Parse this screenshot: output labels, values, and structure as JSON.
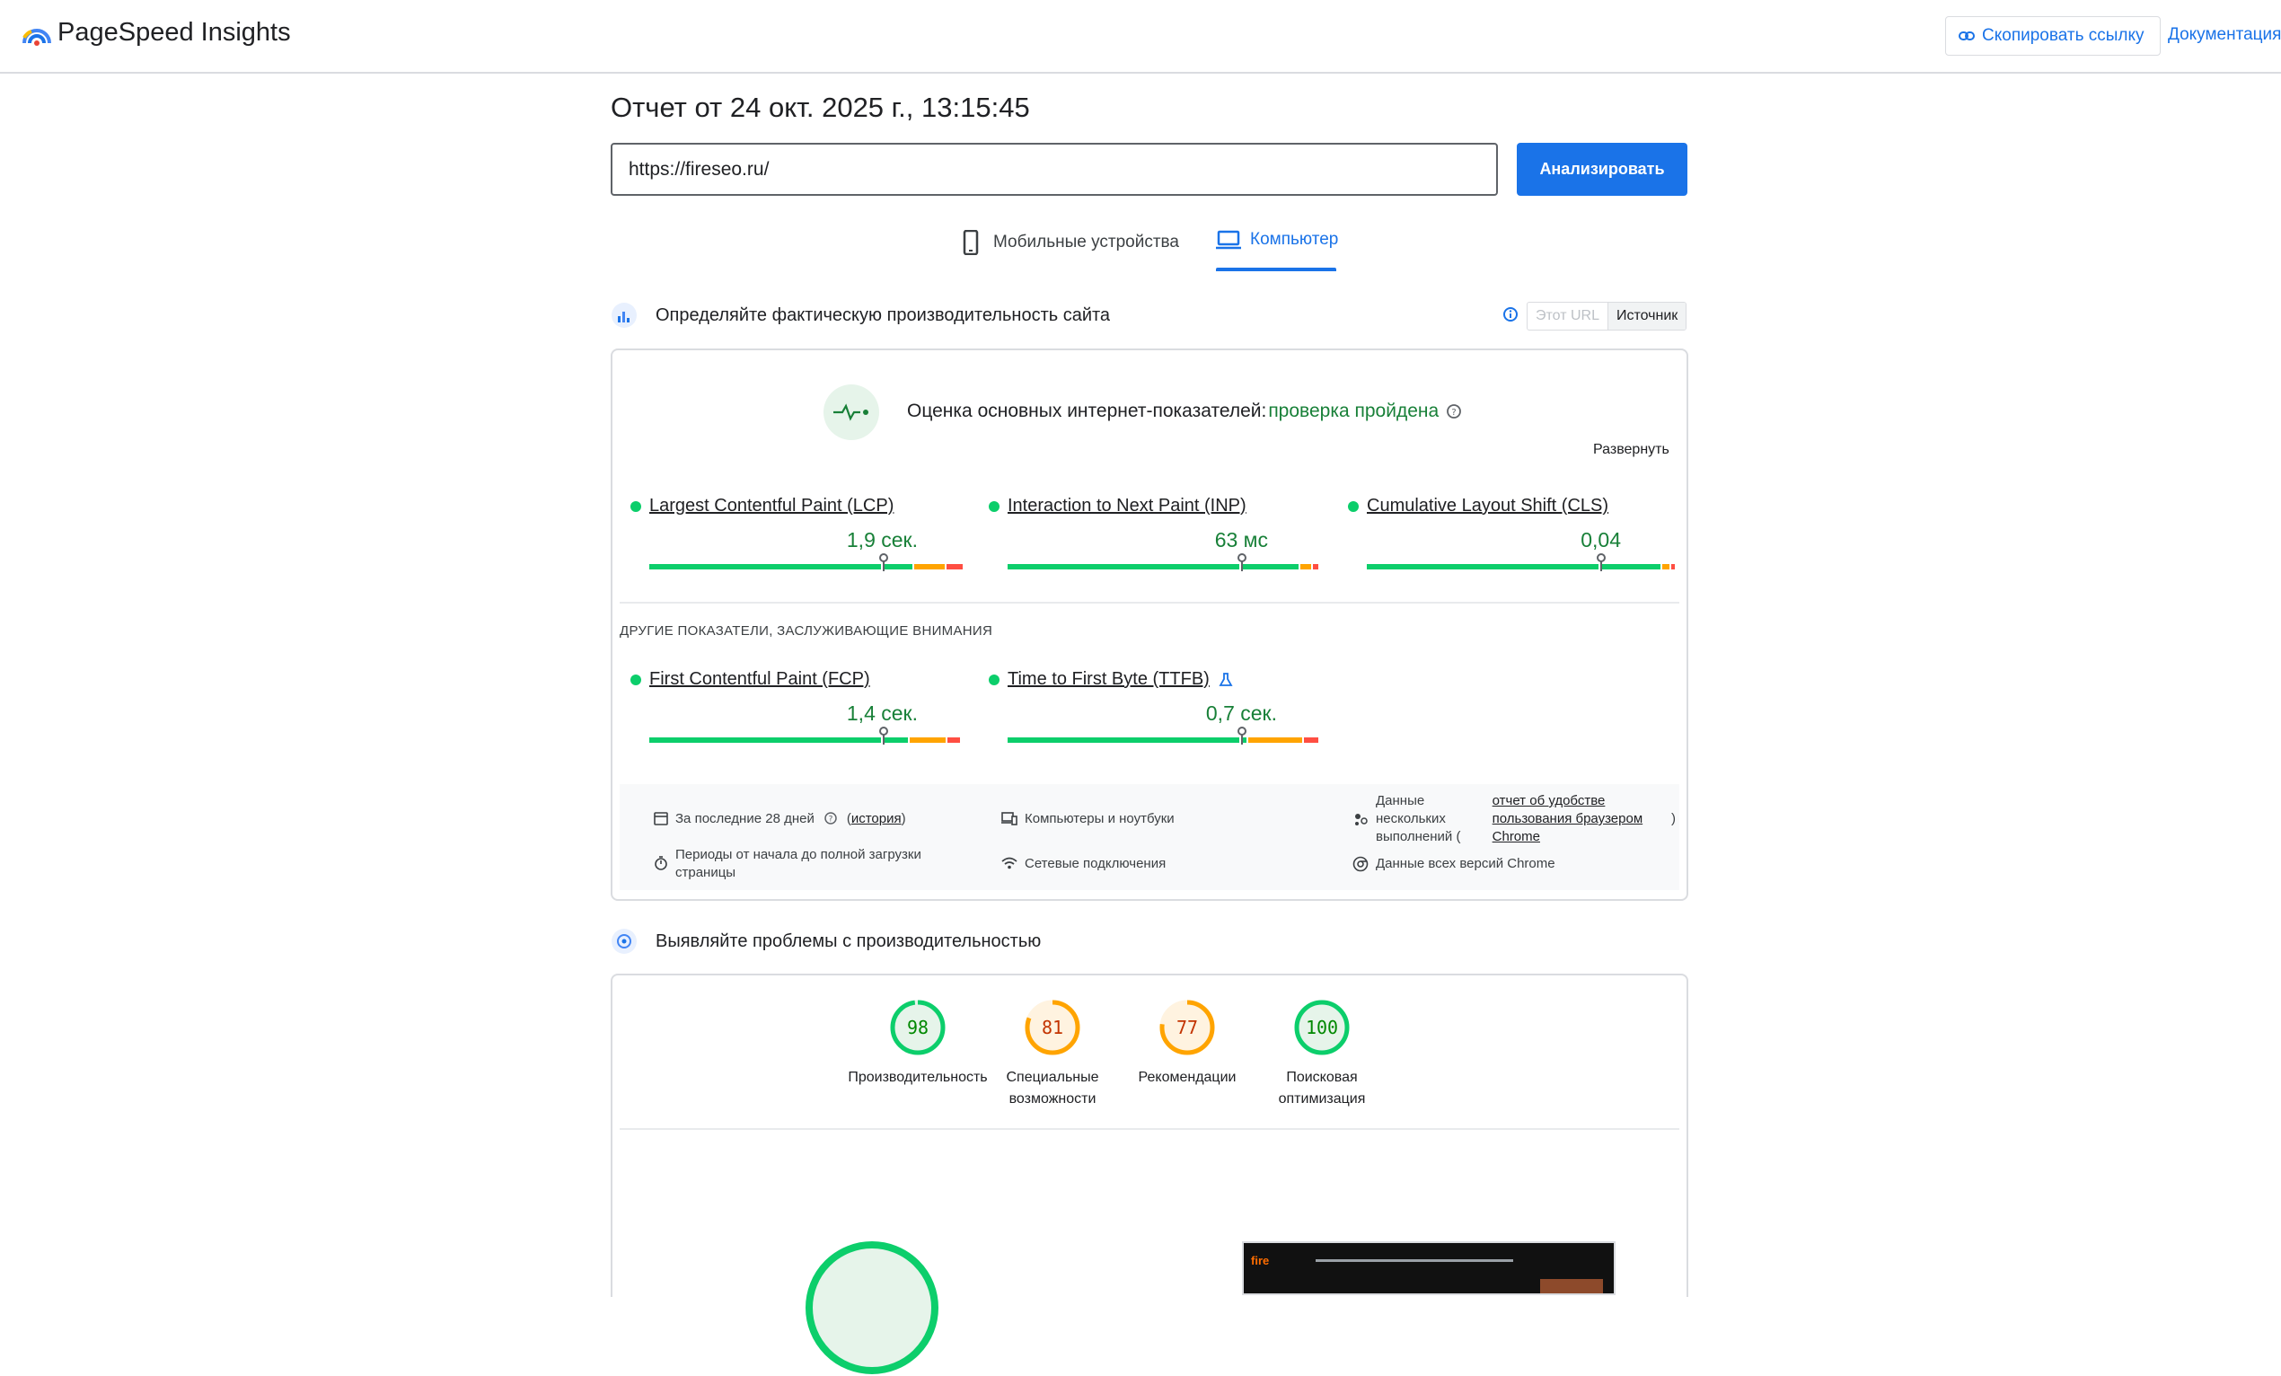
{
  "header": {
    "app_title": "PageSpeed Insights",
    "copy_link_label": "Скопировать ссылку",
    "docs_label": "Документация"
  },
  "report": {
    "title": "Отчет от 24 окт. 2025 г., 13:15:45",
    "url_value": "https://fireseo.ru/",
    "analyze_label": "Анализировать"
  },
  "tabs": {
    "mobile": "Мобильные устройства",
    "desktop": "Компьютер"
  },
  "field": {
    "heading": "Определяйте фактическую производительность сайта",
    "toggle_url": "Этот URL",
    "toggle_origin": "Источник",
    "assessment_label": "Оценка основных интернет-показателей:",
    "assessment_status": "проверка пройдена",
    "expand_label": "Развернуть",
    "metrics": [
      {
        "name": "Largest Contentful Paint (LCP)",
        "value": "1,9 сек."
      },
      {
        "name": "Interaction to Next Paint (INP)",
        "value": "63 мс"
      },
      {
        "name": "Cumulative Layout Shift (CLS)",
        "value": "0,04"
      }
    ],
    "other_label": "ДРУГИЕ ПОКАЗАТЕЛИ, ЗАСЛУЖИВАЮЩИЕ ВНИМАНИЯ",
    "other_metrics": [
      {
        "name": "First Contentful Paint (FCP)",
        "value": "1,4 сек."
      },
      {
        "name": "Time to First Byte (TTFB)",
        "value": "0,7 сек."
      }
    ],
    "info": {
      "period": "За последние 28 дней",
      "history_link": "история",
      "devices": "Компьютеры и ноутбуки",
      "samples_prefix": "Данные нескольких выполнений (",
      "samples_link": "отчет об удобстве пользования браузером Chrome",
      "samples_suffix": ")",
      "duration": "Периоды от начала до полной загрузки страницы",
      "network": "Сетевые подключения",
      "chrome": "Данные всех версий Chrome"
    }
  },
  "lab": {
    "heading": "Выявляйте проблемы с производительностью",
    "scores": [
      {
        "value": "98",
        "label_line1": "Производительность",
        "label_line2": "",
        "color": "#0cce6b",
        "text_color": "#008800"
      },
      {
        "value": "81",
        "label_line1": "Специальные",
        "label_line2": "возможности",
        "color": "#ffa400",
        "text_color": "#c33300"
      },
      {
        "value": "77",
        "label_line1": "Рекомендации",
        "label_line2": "",
        "color": "#ffa400",
        "text_color": "#c33300"
      },
      {
        "value": "100",
        "label_line1": "Поисковая",
        "label_line2": "оптимизация",
        "color": "#0cce6b",
        "text_color": "#008800"
      }
    ]
  },
  "colors": {
    "accent": "#1a73e8",
    "pass": "#0cce6b",
    "average": "#ffa400",
    "fail": "#ff4e42"
  }
}
